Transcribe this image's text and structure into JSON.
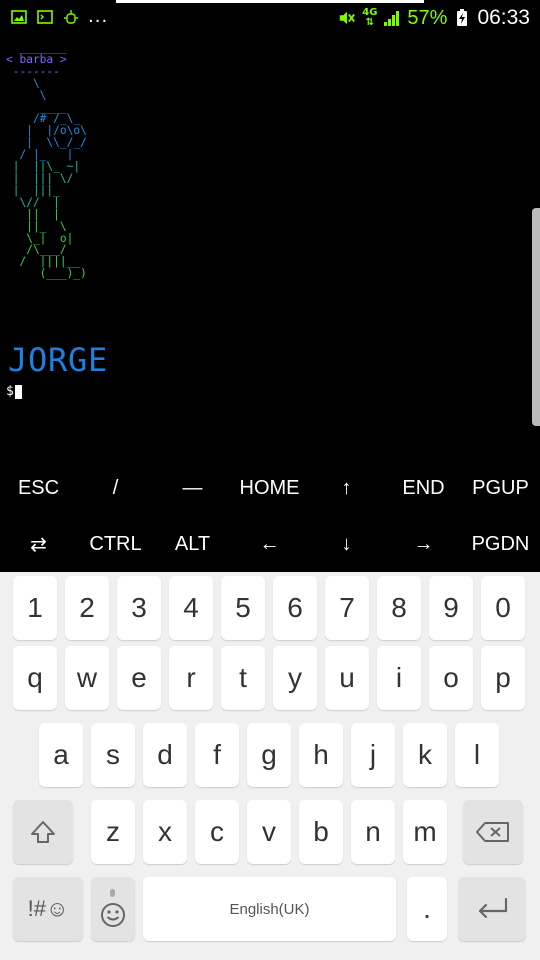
{
  "status_bar": {
    "left_icons": [
      "image-notification-icon",
      "terminal-notification-icon",
      "android-debug-icon"
    ],
    "more_indicator": "...",
    "network_type": "4G",
    "battery_percent": "57%",
    "time": "06:33"
  },
  "terminal": {
    "ascii_lines": [
      "  _______",
      "< barba >",
      " -------",
      "    \\",
      "     \\",
      "     ____",
      "    /# /_\\_",
      "   |  |/o\\o\\",
      "   |  \\\\_/_/",
      "  / |_   |",
      " |  ||\\_ ~|",
      " |  ||| \\/",
      " |  |||_",
      "  \\//  |",
      "   ||  |",
      "   ||_  \\",
      "   \\_|  o|",
      "   /\\___/",
      "  /  ||||__",
      "     (___)_)"
    ],
    "banner_text": "JORGE",
    "prompt": "$"
  },
  "extra_keys": {
    "row1": [
      "ESC",
      "/",
      "—",
      "HOME",
      "↑",
      "END",
      "PGUP"
    ],
    "row2": [
      "⇄",
      "CTRL",
      "ALT",
      "←",
      "↓",
      "→",
      "PGDN"
    ]
  },
  "keyboard": {
    "number_row": [
      "1",
      "2",
      "3",
      "4",
      "5",
      "6",
      "7",
      "8",
      "9",
      "0"
    ],
    "row1": [
      "q",
      "w",
      "e",
      "r",
      "t",
      "y",
      "u",
      "i",
      "o",
      "p"
    ],
    "row2": [
      "a",
      "s",
      "d",
      "f",
      "g",
      "h",
      "j",
      "k",
      "l"
    ],
    "row3": [
      "z",
      "x",
      "c",
      "v",
      "b",
      "n",
      "m"
    ],
    "symbols_label": "!#☺",
    "space_label": "English(UK)",
    "period": "."
  },
  "colors": {
    "terminal_bg": "#000000",
    "ascii_violet": "#7a66ff",
    "ascii_cyan": "#1f8fe0",
    "ascii_green": "#3ad04a",
    "status_green": "#7CFC00",
    "keyboard_bg": "#f0f0f0"
  }
}
